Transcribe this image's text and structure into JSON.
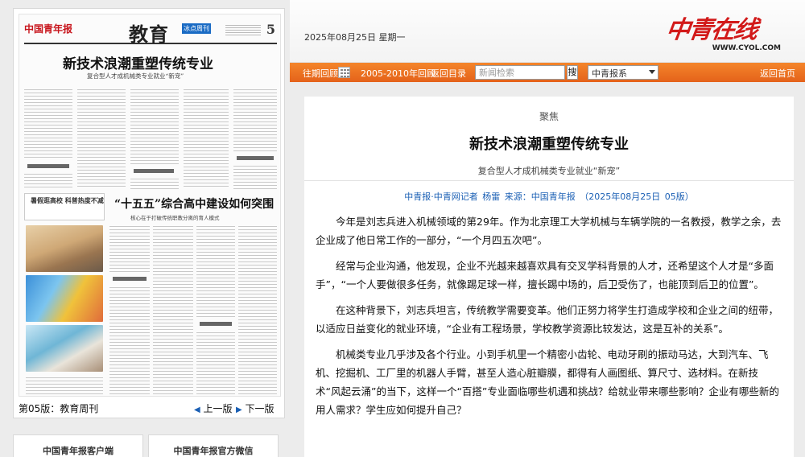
{
  "header": {
    "date": "2025年08月25日 星期一",
    "logo_text": "中青在线",
    "logo_url": "WWW.CYOL.COM"
  },
  "toolbar": {
    "past_review": "往期回顾",
    "archive": "2005-2010年回顾",
    "back_to_index": "返回目录",
    "search_placeholder": "新闻检索",
    "search_button": "搜",
    "paper_select": "中青报系",
    "back_home": "返回首页"
  },
  "newspaper": {
    "logo": "中国青年报",
    "section": "教育",
    "section_tag": "冰点周刊",
    "page_number": "5",
    "headline_1": "新技术浪潮重塑传统专业",
    "subhead_1": "复合型人才成机械类专业就业“新宠”",
    "headline_2": "“十五五”综合高中建设如何突围",
    "subhead_2": "核心在于打破传统职教分离的育人模式",
    "box_text": "暑假逛高校  科普热度不减",
    "page_label": "第05版：教育周刊",
    "prev_page": "上一版",
    "next_page": "下一版"
  },
  "apps": {
    "client": "中国青年报客户端",
    "wechat": "中国青年报官方微信"
  },
  "article": {
    "kicker": "聚焦",
    "title": "新技术浪潮重塑传统专业",
    "subtitle": "复合型人才成机械类专业就业“新宠”",
    "byline": "中青报·中青网记者 杨雷    来源：中国青年报    （2025年08月25日 05版）",
    "paragraphs": [
      "今年是刘志兵进入机械领域的第29年。作为北京理工大学机械与车辆学院的一名教授，教学之余，去企业成了他日常工作的一部分，“一个月四五次吧”。",
      "经常与企业沟通，他发现，企业不光越来越喜欢具有交叉学科背景的人才，还希望这个人才是“多面手”，“一个人要做很多任务，就像踢足球一样，擅长踢中场的，后卫受伤了，也能顶到后卫的位置”。",
      "在这种背景下，刘志兵坦言，传统教学需要变革。他们正努力将学生打造成学校和企业之间的纽带，以适应日益变化的就业环境，“企业有工程场景，学校教学资源比较发达，这是互补的关系”。",
      "机械类专业几乎涉及各个行业。小到手机里一个精密小齿轮、电动牙刷的振动马达，大到汽车、飞机、挖掘机、工厂里的机器人手臂，甚至人造心脏瓣膜，都得有人画图纸、算尺寸、选材料。在新技术“风起云涌”的当下，这样一个“百搭”专业面临哪些机遇和挑战？给就业带来哪些影响？企业有哪些新的用人需求？学生应如何提升自己？"
    ]
  }
}
